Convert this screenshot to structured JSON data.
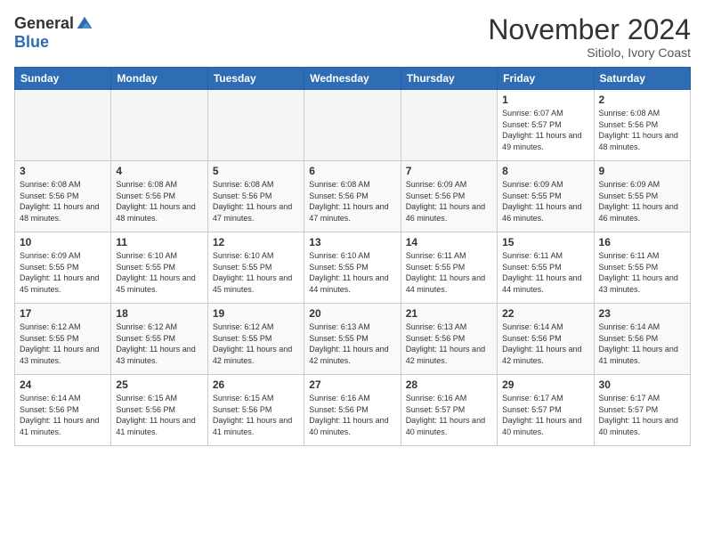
{
  "header": {
    "logo_general": "General",
    "logo_blue": "Blue",
    "month_title": "November 2024",
    "location": "Sitiolo, Ivory Coast"
  },
  "weekdays": [
    "Sunday",
    "Monday",
    "Tuesday",
    "Wednesday",
    "Thursday",
    "Friday",
    "Saturday"
  ],
  "weeks": [
    [
      {
        "day": "",
        "empty": true
      },
      {
        "day": "",
        "empty": true
      },
      {
        "day": "",
        "empty": true
      },
      {
        "day": "",
        "empty": true
      },
      {
        "day": "",
        "empty": true
      },
      {
        "day": "1",
        "sunrise": "6:07 AM",
        "sunset": "5:57 PM",
        "daylight": "11 hours and 49 minutes."
      },
      {
        "day": "2",
        "sunrise": "6:08 AM",
        "sunset": "5:56 PM",
        "daylight": "11 hours and 48 minutes."
      }
    ],
    [
      {
        "day": "3",
        "sunrise": "6:08 AM",
        "sunset": "5:56 PM",
        "daylight": "11 hours and 48 minutes."
      },
      {
        "day": "4",
        "sunrise": "6:08 AM",
        "sunset": "5:56 PM",
        "daylight": "11 hours and 48 minutes."
      },
      {
        "day": "5",
        "sunrise": "6:08 AM",
        "sunset": "5:56 PM",
        "daylight": "11 hours and 47 minutes."
      },
      {
        "day": "6",
        "sunrise": "6:08 AM",
        "sunset": "5:56 PM",
        "daylight": "11 hours and 47 minutes."
      },
      {
        "day": "7",
        "sunrise": "6:09 AM",
        "sunset": "5:56 PM",
        "daylight": "11 hours and 46 minutes."
      },
      {
        "day": "8",
        "sunrise": "6:09 AM",
        "sunset": "5:55 PM",
        "daylight": "11 hours and 46 minutes."
      },
      {
        "day": "9",
        "sunrise": "6:09 AM",
        "sunset": "5:55 PM",
        "daylight": "11 hours and 46 minutes."
      }
    ],
    [
      {
        "day": "10",
        "sunrise": "6:09 AM",
        "sunset": "5:55 PM",
        "daylight": "11 hours and 45 minutes."
      },
      {
        "day": "11",
        "sunrise": "6:10 AM",
        "sunset": "5:55 PM",
        "daylight": "11 hours and 45 minutes."
      },
      {
        "day": "12",
        "sunrise": "6:10 AM",
        "sunset": "5:55 PM",
        "daylight": "11 hours and 45 minutes."
      },
      {
        "day": "13",
        "sunrise": "6:10 AM",
        "sunset": "5:55 PM",
        "daylight": "11 hours and 44 minutes."
      },
      {
        "day": "14",
        "sunrise": "6:11 AM",
        "sunset": "5:55 PM",
        "daylight": "11 hours and 44 minutes."
      },
      {
        "day": "15",
        "sunrise": "6:11 AM",
        "sunset": "5:55 PM",
        "daylight": "11 hours and 44 minutes."
      },
      {
        "day": "16",
        "sunrise": "6:11 AM",
        "sunset": "5:55 PM",
        "daylight": "11 hours and 43 minutes."
      }
    ],
    [
      {
        "day": "17",
        "sunrise": "6:12 AM",
        "sunset": "5:55 PM",
        "daylight": "11 hours and 43 minutes."
      },
      {
        "day": "18",
        "sunrise": "6:12 AM",
        "sunset": "5:55 PM",
        "daylight": "11 hours and 43 minutes."
      },
      {
        "day": "19",
        "sunrise": "6:12 AM",
        "sunset": "5:55 PM",
        "daylight": "11 hours and 42 minutes."
      },
      {
        "day": "20",
        "sunrise": "6:13 AM",
        "sunset": "5:55 PM",
        "daylight": "11 hours and 42 minutes."
      },
      {
        "day": "21",
        "sunrise": "6:13 AM",
        "sunset": "5:56 PM",
        "daylight": "11 hours and 42 minutes."
      },
      {
        "day": "22",
        "sunrise": "6:14 AM",
        "sunset": "5:56 PM",
        "daylight": "11 hours and 42 minutes."
      },
      {
        "day": "23",
        "sunrise": "6:14 AM",
        "sunset": "5:56 PM",
        "daylight": "11 hours and 41 minutes."
      }
    ],
    [
      {
        "day": "24",
        "sunrise": "6:14 AM",
        "sunset": "5:56 PM",
        "daylight": "11 hours and 41 minutes."
      },
      {
        "day": "25",
        "sunrise": "6:15 AM",
        "sunset": "5:56 PM",
        "daylight": "11 hours and 41 minutes."
      },
      {
        "day": "26",
        "sunrise": "6:15 AM",
        "sunset": "5:56 PM",
        "daylight": "11 hours and 41 minutes."
      },
      {
        "day": "27",
        "sunrise": "6:16 AM",
        "sunset": "5:56 PM",
        "daylight": "11 hours and 40 minutes."
      },
      {
        "day": "28",
        "sunrise": "6:16 AM",
        "sunset": "5:57 PM",
        "daylight": "11 hours and 40 minutes."
      },
      {
        "day": "29",
        "sunrise": "6:17 AM",
        "sunset": "5:57 PM",
        "daylight": "11 hours and 40 minutes."
      },
      {
        "day": "30",
        "sunrise": "6:17 AM",
        "sunset": "5:57 PM",
        "daylight": "11 hours and 40 minutes."
      }
    ]
  ]
}
